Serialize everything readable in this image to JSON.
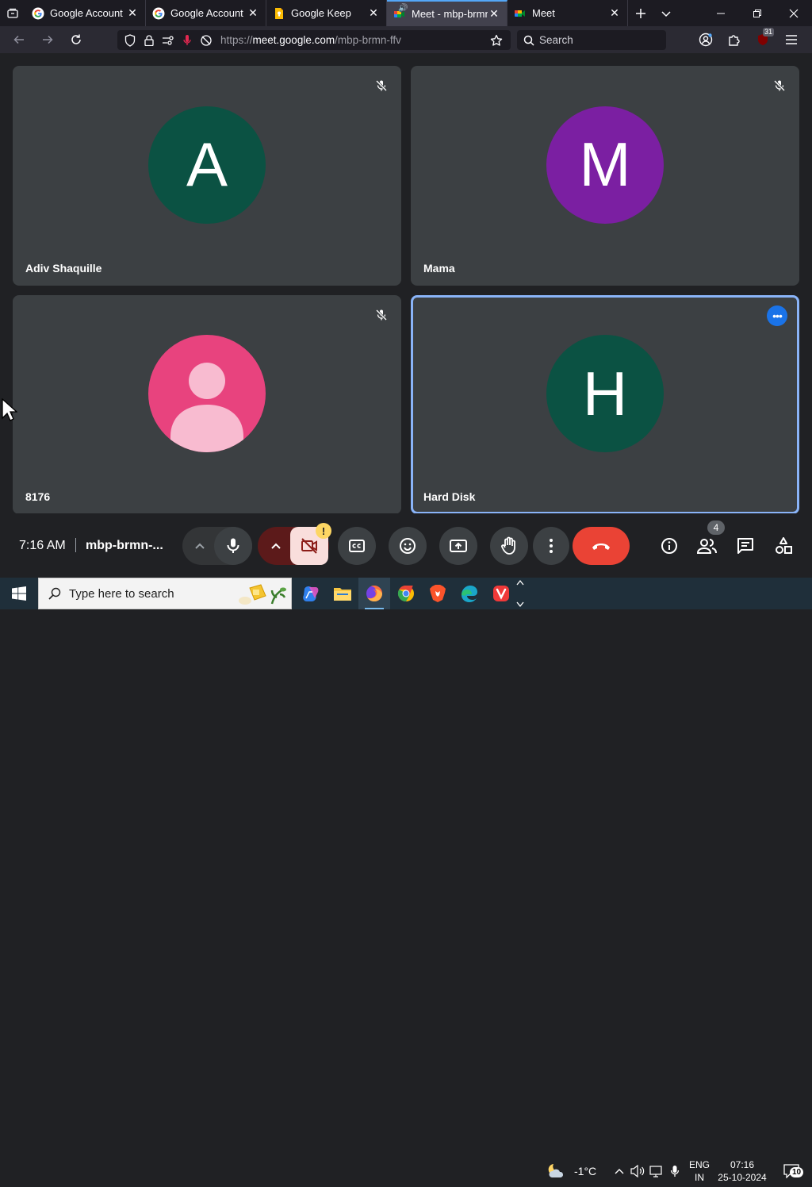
{
  "browser": {
    "tabs": [
      {
        "title": "Google Account",
        "favicon": "google-g-icon",
        "active": false
      },
      {
        "title": "Google Account",
        "favicon": "google-g-icon",
        "active": false
      },
      {
        "title": "Google Keep",
        "favicon": "google-keep-icon",
        "active": false
      },
      {
        "title": "Meet - mbp-brmn",
        "favicon": "google-meet-icon",
        "active": true,
        "audio": true
      },
      {
        "title": "Meet",
        "favicon": "google-meet-icon",
        "active": false
      }
    ],
    "url_prefix": "https://",
    "url_host": "meet.google.com",
    "url_path": "/mbp-brmn-ffv",
    "search_placeholder": "Search",
    "extension_badge": "31"
  },
  "meet": {
    "participants": [
      {
        "name": "Adiv Shaquille",
        "initial": "A",
        "avatar_color": "#0b5243",
        "muted": true,
        "speaking": false,
        "photo": false
      },
      {
        "name": "Mama",
        "initial": "M",
        "avatar_color": "#7b1fa2",
        "muted": true,
        "speaking": false,
        "photo": false
      },
      {
        "name": "8176",
        "initial": "",
        "avatar_color": "#e8437e",
        "muted": true,
        "speaking": false,
        "photo": true
      },
      {
        "name": "Hard Disk",
        "initial": "H",
        "avatar_color": "#0b5243",
        "muted": false,
        "speaking": true,
        "photo": false
      }
    ],
    "time": "7:16 AM",
    "meeting_code": "mbp-brmn-...",
    "camera_alert": "!",
    "participant_count": "4"
  },
  "taskbar": {
    "search_placeholder": "Type here to search",
    "weather": "-1°C",
    "language_line1": "ENG",
    "language_line2": "IN",
    "time": "07:16",
    "date": "25-10-2024",
    "notification_count": "10"
  },
  "colors": {
    "accent": "#8ab4f8",
    "end_call": "#ea4335",
    "camera_off": "#f9dedc",
    "camera_off_arrow": "#8c1d18"
  }
}
